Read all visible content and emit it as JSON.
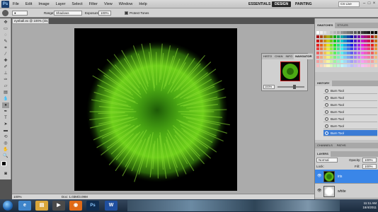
{
  "app": {
    "logo": "Ps"
  },
  "menubar": {
    "items": [
      "File",
      "Edit",
      "Image",
      "Layer",
      "Select",
      "Filter",
      "View",
      "Window",
      "Help"
    ],
    "workspaces": {
      "essentials": "ESSENTIALS",
      "design": "DESIGN",
      "painting": "PAINTING"
    },
    "cs_live": "CS Live"
  },
  "options": {
    "range_label": "Range:",
    "range_value": "Shadows",
    "exposure_label": "Exposure:",
    "exposure_value": "100%",
    "protect_label": "Protect Tones"
  },
  "document": {
    "tab_title": "eyeball.ex @ 100% (iris, RGB/8)",
    "zoom": "100%",
    "doc_size": "Doc: 1.03M/3.09M"
  },
  "navigator": {
    "tabs": [
      "HISTO",
      "CHAN",
      "INFO",
      "NAVIGATOR"
    ],
    "active": "NAVIGATOR",
    "zoom": "100%"
  },
  "panels": {
    "swatch_tabs": [
      "SWATCHES",
      "STYLES"
    ],
    "history_tabs": [
      "HISTORY"
    ],
    "history_items": [
      "Burn Tool",
      "Burn Tool",
      "Burn Tool",
      "Burn Tool",
      "Burn Tool",
      "Burn Tool",
      "Burn Tool"
    ],
    "layer_tabs": [
      "CHANNELS",
      "PATHS"
    ],
    "layers_title": "LAYERS",
    "blend_mode": "Normal",
    "opacity_label": "Opacity:",
    "opacity": "100%",
    "lock_label": "Lock:",
    "fill_label": "Fill:",
    "fill": "100%",
    "layers": [
      {
        "name": "iris",
        "active": true
      },
      {
        "name": "white",
        "active": false
      }
    ]
  },
  "taskbar": {
    "time": "11:11 AM",
    "date": "18/4/2011"
  },
  "colors": {
    "accent": "#3a86e8",
    "iris_green": "#6ecf1a"
  }
}
